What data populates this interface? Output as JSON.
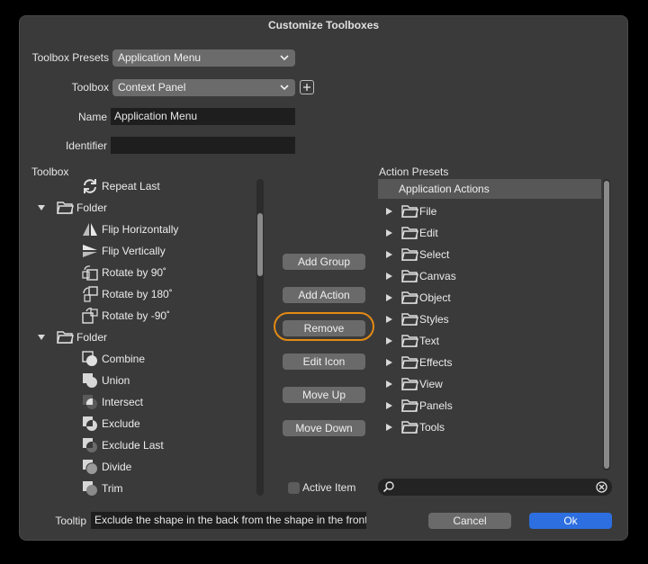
{
  "dialog": {
    "title": "Customize Toolboxes"
  },
  "form": {
    "toolbox_presets_label": "Toolbox Presets",
    "toolbox_presets_value": "Application Menu",
    "toolbox_label": "Toolbox",
    "toolbox_value": "Context Panel",
    "name_label": "Name",
    "name_value": "Application Menu",
    "identifier_label": "Identifier",
    "identifier_value": ""
  },
  "toolbox_tree": {
    "label": "Toolbox",
    "items": [
      {
        "label": "Repeat Last",
        "icon": "repeat-icon",
        "type": "item",
        "indent": 1
      },
      {
        "label": "Folder",
        "icon": "folder-icon",
        "type": "folder",
        "indent": 0
      },
      {
        "label": "Flip Horizontally",
        "icon": "flip-horizontal-icon",
        "type": "item",
        "indent": 1
      },
      {
        "label": "Flip Vertically",
        "icon": "flip-vertical-icon",
        "type": "item",
        "indent": 1
      },
      {
        "label": "Rotate by 90˚",
        "icon": "rotate-90-icon",
        "type": "item",
        "indent": 1
      },
      {
        "label": "Rotate by 180˚",
        "icon": "rotate-180-icon",
        "type": "item",
        "indent": 1
      },
      {
        "label": "Rotate by -90˚",
        "icon": "rotate-minus-90-icon",
        "type": "item",
        "indent": 1
      },
      {
        "label": "Folder",
        "icon": "folder-icon",
        "type": "folder",
        "indent": 0
      },
      {
        "label": "Combine",
        "icon": "combine-icon",
        "type": "item",
        "indent": 1
      },
      {
        "label": "Union",
        "icon": "union-icon",
        "type": "item",
        "indent": 1
      },
      {
        "label": "Intersect",
        "icon": "intersect-icon",
        "type": "item",
        "indent": 1
      },
      {
        "label": "Exclude",
        "icon": "exclude-icon",
        "type": "item",
        "indent": 1
      },
      {
        "label": "Exclude Last",
        "icon": "exclude-last-icon",
        "type": "item",
        "indent": 1
      },
      {
        "label": "Divide",
        "icon": "divide-icon",
        "type": "item",
        "indent": 1
      },
      {
        "label": "Trim",
        "icon": "trim-icon",
        "type": "item",
        "indent": 1
      }
    ]
  },
  "actions": {
    "add_group": "Add Group",
    "add_action": "Add Action",
    "remove": "Remove",
    "edit_icon": "Edit Icon",
    "move_up": "Move Up",
    "move_down": "Move Down",
    "active_item": "Active Item"
  },
  "action_presets": {
    "label": "Action Presets",
    "header": "Application Actions",
    "items": [
      "File",
      "Edit",
      "Select",
      "Canvas",
      "Object",
      "Styles",
      "Text",
      "Effects",
      "View",
      "Panels",
      "Tools"
    ]
  },
  "footer": {
    "tooltip_label": "Tooltip",
    "tooltip_value": "Exclude the shape in the back from the shape in the front",
    "cancel": "Cancel",
    "ok": "Ok"
  },
  "colors": {
    "dialog_bg": "#3a3a3a",
    "ok_button": "#2d6fe0",
    "highlight_ring": "#e38a14"
  }
}
